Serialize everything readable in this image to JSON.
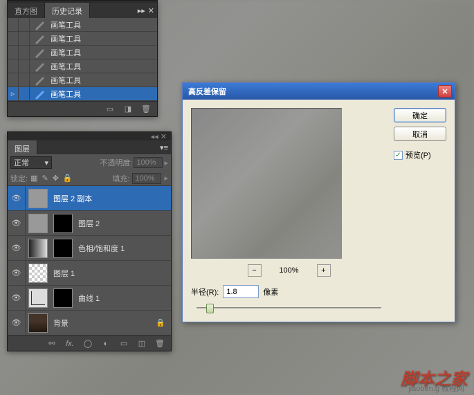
{
  "history_panel": {
    "tabs": [
      "直方图",
      "历史记录"
    ],
    "active_tab": 1,
    "items": [
      {
        "label": "画笔工具",
        "selected": false
      },
      {
        "label": "画笔工具",
        "selected": false
      },
      {
        "label": "画笔工具",
        "selected": false
      },
      {
        "label": "画笔工具",
        "selected": false
      },
      {
        "label": "画笔工具",
        "selected": false
      },
      {
        "label": "画笔工具",
        "selected": true
      }
    ]
  },
  "layers_panel": {
    "tab": "图层",
    "blend_mode": "正常",
    "opacity_label": "不透明度:",
    "opacity_value": "100%",
    "lock_label": "锁定:",
    "fill_label": "填充:",
    "fill_value": "100%",
    "layers": [
      {
        "name": "图层 2 副本",
        "thumb": "gray",
        "mask": null,
        "selected": true,
        "locked": false
      },
      {
        "name": "图层 2",
        "thumb": "gray",
        "mask": "mask",
        "selected": false,
        "locked": false
      },
      {
        "name": "色相/饱和度 1",
        "thumb": "gradient",
        "mask": "mask",
        "selected": false,
        "locked": false
      },
      {
        "name": "图层 1",
        "thumb": "checker",
        "mask": null,
        "selected": false,
        "locked": false
      },
      {
        "name": "曲线 1",
        "thumb": "curves",
        "mask": "mask",
        "selected": false,
        "locked": false
      },
      {
        "name": "背景",
        "thumb": "face",
        "mask": null,
        "selected": false,
        "locked": true
      }
    ]
  },
  "dialog": {
    "title": "高反差保留",
    "ok": "确定",
    "cancel": "取消",
    "preview_label": "预览(P)",
    "preview_checked": true,
    "zoom": "100%",
    "radius_label": "半径(R):",
    "radius_value": "1.8",
    "radius_unit": "像素"
  },
  "watermark": "脚本之家",
  "watermark_url": "jiaoben.g 教程网"
}
